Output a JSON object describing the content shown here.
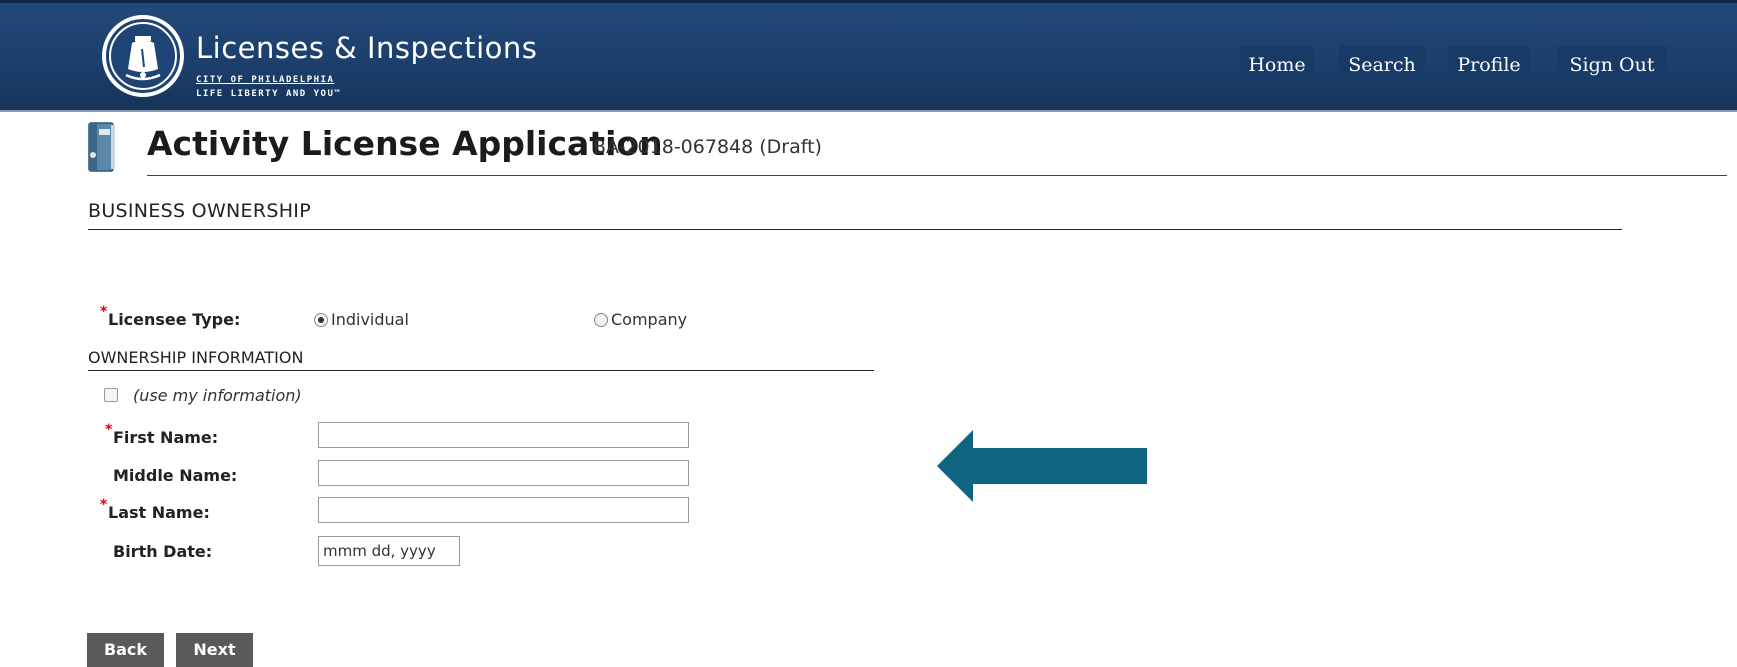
{
  "header": {
    "brand_title": "Licenses & Inspections",
    "brand_sub1": "CITY OF PHILADELPHIA",
    "brand_sub2": "LIFE LIBERTY AND YOU™",
    "nav": [
      "Home",
      "Search",
      "Profile",
      "Sign Out"
    ]
  },
  "page": {
    "title": "Activity License Application",
    "subtitle": "BA-2018-067848 (Draft)",
    "section_heading": "BUSINESS OWNERSHIP"
  },
  "form": {
    "licensee_type_label": "Licensee Type:",
    "licensee_options": [
      "Individual",
      "Company"
    ],
    "licensee_selected": "Individual",
    "ownership_heading": "OWNERSHIP INFORMATION",
    "use_my_info_label": "(use my information)",
    "first_name_label": "First Name:",
    "middle_name_label": "Middle Name:",
    "last_name_label": "Last Name:",
    "birth_date_label": "Birth Date:",
    "birth_date_value": "mmm dd, yyyy"
  },
  "buttons": {
    "back": "Back",
    "next": "Next"
  },
  "colors": {
    "header_bg": "#1c3f6c",
    "nav_bg": "#173a66",
    "arrow": "#0f6480",
    "required": "#dd0000",
    "button_bg": "#5a5a5a"
  }
}
